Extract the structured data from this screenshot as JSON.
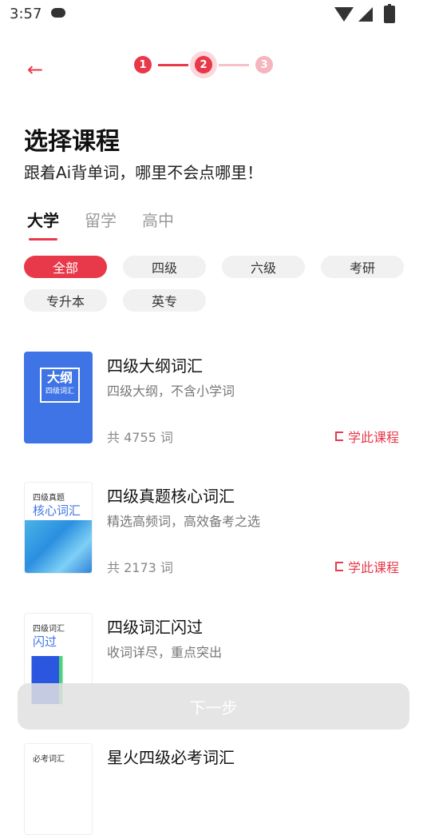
{
  "status_bar": {
    "time": "3:57"
  },
  "header": {
    "back_icon": "←",
    "steps": [
      "1",
      "2",
      "3"
    ]
  },
  "page": {
    "title": "选择课程",
    "subtitle": "跟着Ai背单词，哪里不会点哪里！"
  },
  "tabs": [
    "大学",
    "留学",
    "高中"
  ],
  "filters": [
    "全部",
    "四级",
    "六级",
    "考研",
    "专升本",
    "英专"
  ],
  "books": [
    {
      "cover_big": "大纲",
      "cover_small": "四级词汇",
      "title": "四级大纲词汇",
      "desc": "四级大纲，不含小学词",
      "count": "共 4755 词",
      "action": "学此课程"
    },
    {
      "cover_small": "四级真题",
      "cover_big": "核心词汇",
      "title": "四级真题核心词汇",
      "desc": "精选高频词，高效备考之选",
      "count": "共 2173 词",
      "action": "学此课程"
    },
    {
      "cover_small": "四级词汇",
      "cover_big": "闪过",
      "title": "四级词汇闪过",
      "desc": "收词详尽，重点突出"
    },
    {
      "cover_small": "必考词汇",
      "title": "星火四级必考词汇"
    }
  ],
  "footer": {
    "next_label": "下一步"
  }
}
